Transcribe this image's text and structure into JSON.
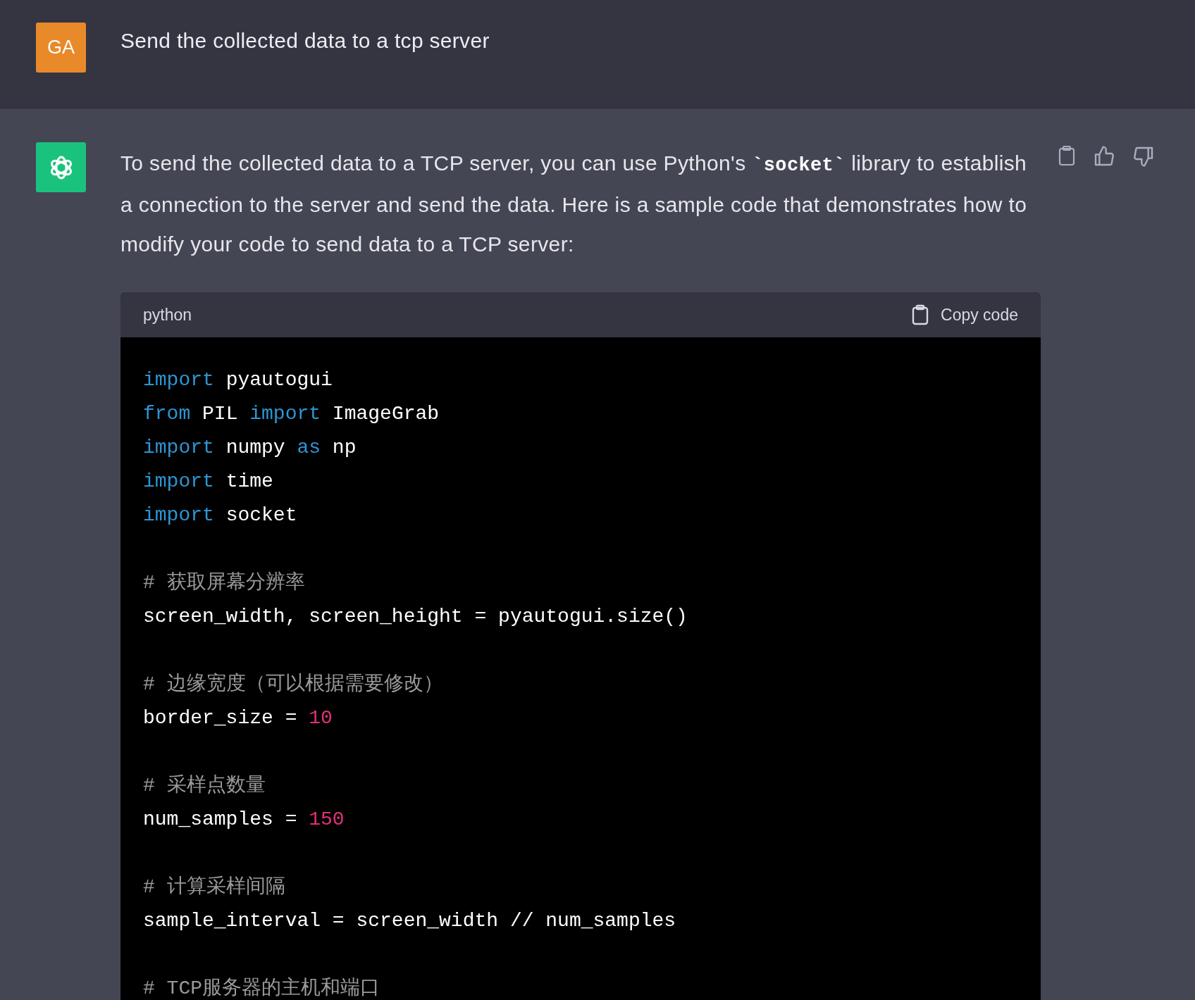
{
  "user_message": {
    "avatar": "GA",
    "text": "Send the collected data to a tcp server"
  },
  "assistant_message": {
    "paragraph": [
      {
        "kind": "text",
        "text": "To send the collected data to a TCP server, you can use Python's "
      },
      {
        "kind": "code",
        "text": "`socket`"
      },
      {
        "kind": "text",
        "text": " library to establish a connection to the server and send the data. Here is a sample code that demonstrates how to modify your code to send data to a TCP server:"
      }
    ],
    "code_block": {
      "language": "python",
      "copy_label": "Copy code",
      "groups": [
        [
          [
            {
              "kind": "keyword",
              "text": "import"
            },
            {
              "kind": "plain",
              "text": " pyautogui"
            }
          ],
          [
            {
              "kind": "keyword",
              "text": "from"
            },
            {
              "kind": "plain",
              "text": " PIL "
            },
            {
              "kind": "keyword",
              "text": "import"
            },
            {
              "kind": "plain",
              "text": " ImageGrab"
            }
          ],
          [
            {
              "kind": "keyword",
              "text": "import"
            },
            {
              "kind": "plain",
              "text": " numpy "
            },
            {
              "kind": "keyword",
              "text": "as"
            },
            {
              "kind": "plain",
              "text": " np"
            }
          ],
          [
            {
              "kind": "keyword",
              "text": "import"
            },
            {
              "kind": "plain",
              "text": " time"
            }
          ],
          [
            {
              "kind": "keyword",
              "text": "import"
            },
            {
              "kind": "plain",
              "text": " socket"
            }
          ]
        ],
        [
          [
            {
              "kind": "comment",
              "text": "# 获取屏幕分辨率"
            }
          ],
          [
            {
              "kind": "plain",
              "text": "screen_width, screen_height = pyautogui.size()"
            }
          ]
        ],
        [
          [
            {
              "kind": "comment",
              "text": "# 边缘宽度（可以根据需要修改）"
            }
          ],
          [
            {
              "kind": "plain",
              "text": "border_size = "
            },
            {
              "kind": "number",
              "text": "10"
            }
          ]
        ],
        [
          [
            {
              "kind": "comment",
              "text": "# 采样点数量"
            }
          ],
          [
            {
              "kind": "plain",
              "text": "num_samples = "
            },
            {
              "kind": "number",
              "text": "150"
            }
          ]
        ],
        [
          [
            {
              "kind": "comment",
              "text": "# 计算采样间隔"
            }
          ],
          [
            {
              "kind": "plain",
              "text": "sample_interval = screen_width // num_samples"
            }
          ]
        ],
        [
          [
            {
              "kind": "comment",
              "text": "# TCP服务器的主机和端口"
            }
          ]
        ]
      ]
    }
  }
}
